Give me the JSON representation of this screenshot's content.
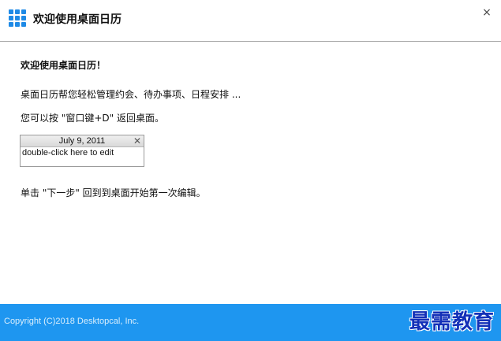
{
  "window": {
    "title": "欢迎使用桌面日历",
    "close_glyph": "×"
  },
  "content": {
    "heading": "欢迎使用桌面日历！",
    "line1": "桌面日历帮您轻松管理约会、待办事项、日程安排 ...",
    "line2": "您可以按 \"窗口键+D\" 返回桌面。",
    "line3": "单击 \"下一步\" 回到到桌面开始第一次编辑。"
  },
  "note": {
    "date": "July 9, 2011",
    "close_glyph": "✕",
    "text": "double-click here to edit"
  },
  "footer": {
    "copyright": "Copyright (C)2018 Desktopcal, Inc.",
    "watermark": "最需教育"
  },
  "colors": {
    "accent": "#1e96f0",
    "logo": "#1e8ae6",
    "watermark": "#1330b8"
  }
}
